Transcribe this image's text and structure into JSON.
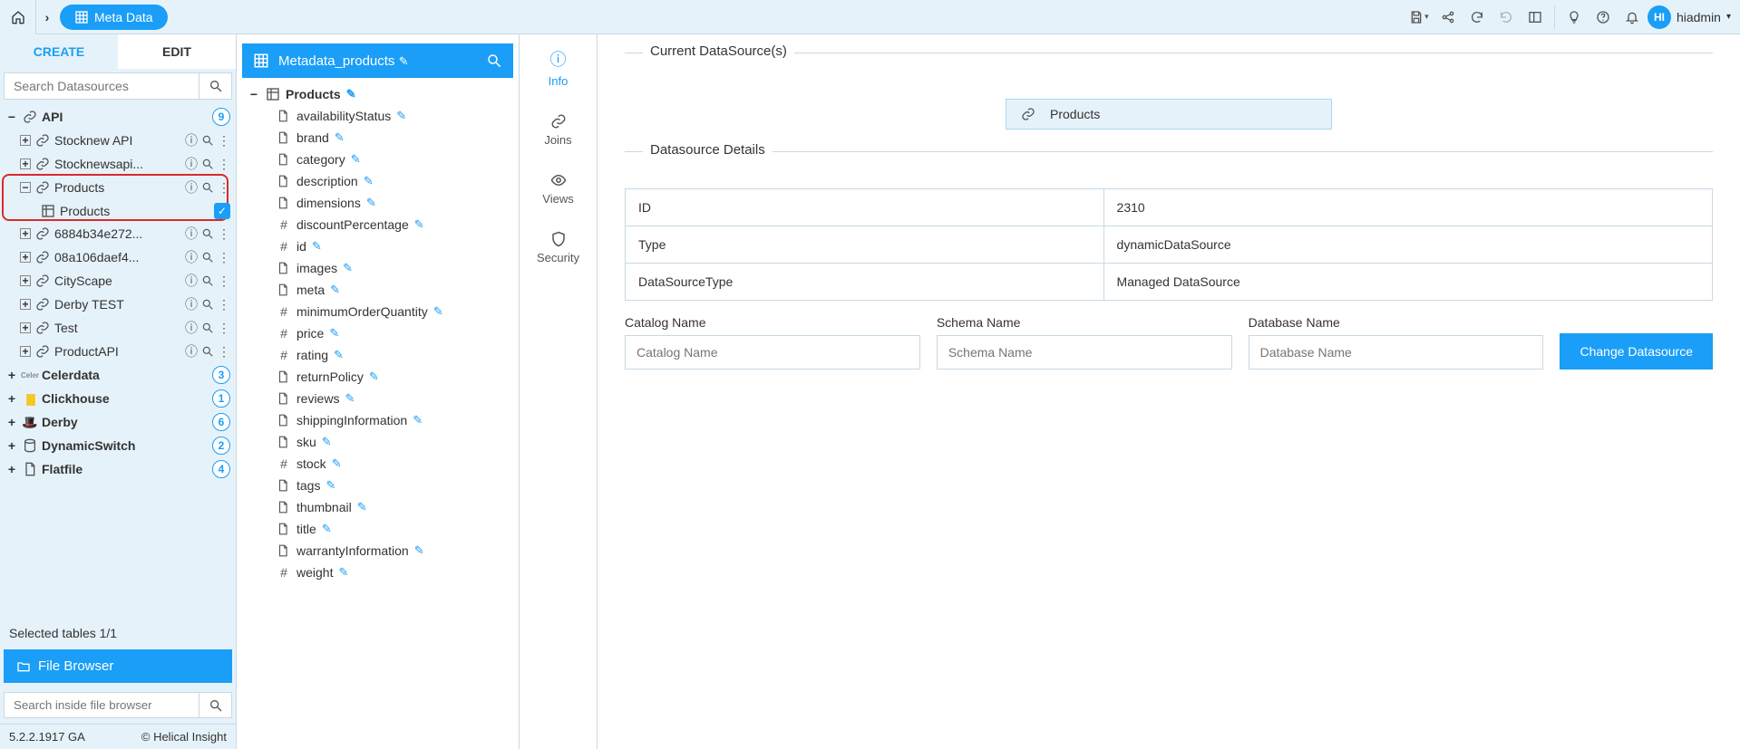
{
  "topbar": {
    "page_tab": "Meta Data",
    "user_initials": "HI",
    "user_name": "hiadmin"
  },
  "left": {
    "tab_create": "CREATE",
    "tab_edit": "EDIT",
    "search_placeholder": "Search Datasources",
    "api_label": "API",
    "api_count": "9",
    "api_children": [
      {
        "label": "Stocknew API"
      },
      {
        "label": "Stocknewsapi..."
      },
      {
        "label": "Products",
        "expanded": true,
        "child": "Products",
        "highlighted": true
      },
      {
        "label": "6884b34e272..."
      },
      {
        "label": "08a106daef4..."
      },
      {
        "label": "CityScape"
      },
      {
        "label": "Derby TEST"
      },
      {
        "label": "Test"
      },
      {
        "label": "ProductAPI"
      }
    ],
    "other_sources": [
      {
        "label": "Celerdata",
        "count": "3",
        "logo": "celerdata"
      },
      {
        "label": "Clickhouse",
        "count": "1",
        "logo": "clickhouse"
      },
      {
        "label": "Derby",
        "count": "6",
        "logo": "derby"
      },
      {
        "label": "DynamicSwitch",
        "count": "2",
        "logo": "db"
      },
      {
        "label": "Flatfile",
        "count": "4",
        "logo": "file"
      }
    ],
    "selected_text": "Selected tables 1/1",
    "file_browser": "File Browser",
    "file_search_placeholder": "Search inside file browser",
    "version": "5.2.2.1917 GA",
    "copyright": "Helical Insight"
  },
  "mid": {
    "title": "Metadata_products",
    "root": "Products",
    "fields": [
      {
        "name": "availabilityStatus",
        "type": "text"
      },
      {
        "name": "brand",
        "type": "text"
      },
      {
        "name": "category",
        "type": "text"
      },
      {
        "name": "description",
        "type": "text"
      },
      {
        "name": "dimensions",
        "type": "text"
      },
      {
        "name": "discountPercentage",
        "type": "num"
      },
      {
        "name": "id",
        "type": "num"
      },
      {
        "name": "images",
        "type": "text"
      },
      {
        "name": "meta",
        "type": "text"
      },
      {
        "name": "minimumOrderQuantity",
        "type": "num"
      },
      {
        "name": "price",
        "type": "num"
      },
      {
        "name": "rating",
        "type": "num"
      },
      {
        "name": "returnPolicy",
        "type": "text"
      },
      {
        "name": "reviews",
        "type": "text"
      },
      {
        "name": "shippingInformation",
        "type": "text"
      },
      {
        "name": "sku",
        "type": "text"
      },
      {
        "name": "stock",
        "type": "num"
      },
      {
        "name": "tags",
        "type": "text"
      },
      {
        "name": "thumbnail",
        "type": "text"
      },
      {
        "name": "title",
        "type": "text"
      },
      {
        "name": "warrantyInformation",
        "type": "text"
      },
      {
        "name": "weight",
        "type": "num"
      }
    ]
  },
  "nav": {
    "info": "Info",
    "joins": "Joins",
    "views": "Views",
    "security": "Security"
  },
  "right": {
    "current_ds_title": "Current DataSource(s)",
    "ds_chip": "Products",
    "details_title": "Datasource Details",
    "rows": [
      {
        "k": "ID",
        "v": "2310"
      },
      {
        "k": "Type",
        "v": "dynamicDataSource"
      },
      {
        "k": "DataSourceType",
        "v": "Managed DataSource"
      }
    ],
    "catalog_label": "Catalog Name",
    "catalog_placeholder": "Catalog Name",
    "schema_label": "Schema Name",
    "schema_placeholder": "Schema Name",
    "db_label": "Database Name",
    "db_placeholder": "Database Name",
    "change_btn": "Change Datasource"
  }
}
